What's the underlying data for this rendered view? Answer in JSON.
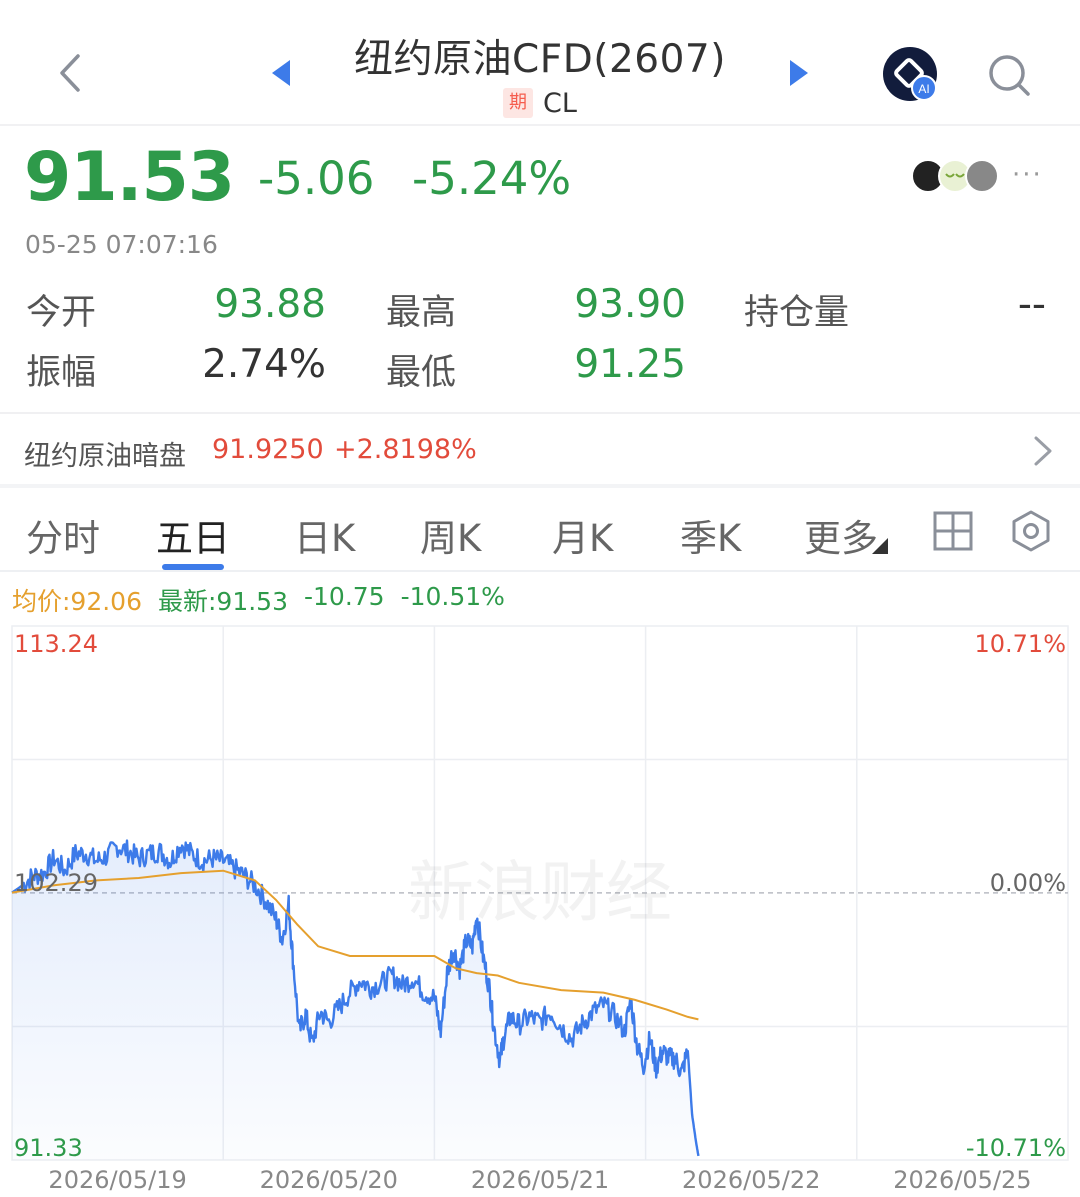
{
  "header": {
    "title": "纽约原油CFD(2607)",
    "badge": "期",
    "code": "CL",
    "ai_label": "AI"
  },
  "quote": {
    "price": "91.53",
    "change": "-5.06",
    "change_pct": "-5.24%",
    "timestamp": "05-25 07:07:16",
    "more": "···"
  },
  "stats": {
    "open_label": "今开",
    "open": "93.88",
    "high_label": "最高",
    "high": "93.90",
    "oi_label": "持仓量",
    "oi": "--",
    "amp_label": "振幅",
    "amp": "2.74%",
    "low_label": "最低",
    "low": "91.25"
  },
  "dark_pool": {
    "label": "纽约原油暗盘",
    "price": "91.9250",
    "pct": "+2.8198%"
  },
  "tabs": [
    {
      "label": "分时"
    },
    {
      "label": "五日"
    },
    {
      "label": "日K"
    },
    {
      "label": "周K"
    },
    {
      "label": "月K"
    },
    {
      "label": "季K"
    },
    {
      "label": "更多"
    }
  ],
  "chart_legend": {
    "avg": "均价:92.06",
    "latest": "最新:91.53",
    "change": "-10.75",
    "pct": "-10.51%"
  },
  "colors": {
    "down": "#2e9a4a",
    "up": "#e24b3b",
    "accent": "#3d7be9",
    "avg_line": "#e5a02e"
  },
  "chart_data": {
    "type": "line",
    "title": "",
    "y_left_ticks": [
      "113.24",
      "102.29",
      "91.33"
    ],
    "y_right_ticks": [
      "10.71%",
      "0.00%",
      "-10.71%"
    ],
    "ylim": [
      91.33,
      113.24
    ],
    "base_price": 102.29,
    "x_labels": [
      "2026/05/19",
      "2026/05/20",
      "2026/05/21",
      "2026/05/22",
      "2026/05/25"
    ],
    "watermark": "新浪财经",
    "series": [
      {
        "values": [
          [
            0.0,
            102.3
          ],
          [
            0.05,
            102.6
          ],
          [
            0.1,
            103.0
          ],
          [
            0.15,
            103.1
          ],
          [
            0.2,
            103.7
          ],
          [
            0.25,
            103.2
          ],
          [
            0.3,
            103.9
          ],
          [
            0.35,
            103.9
          ],
          [
            0.4,
            103.6
          ],
          [
            0.45,
            103.8
          ],
          [
            0.5,
            104.2
          ],
          [
            0.55,
            104.0
          ],
          [
            0.6,
            103.7
          ],
          [
            0.65,
            103.9
          ],
          [
            0.7,
            104.0
          ],
          [
            0.75,
            103.6
          ],
          [
            0.8,
            104.3
          ],
          [
            0.85,
            103.9
          ],
          [
            0.9,
            103.6
          ],
          [
            0.95,
            103.7
          ],
          [
            1.0,
            103.6
          ],
          [
            1.05,
            103.3
          ],
          [
            1.1,
            103.0
          ],
          [
            1.15,
            102.6
          ],
          [
            1.2,
            102.0
          ],
          [
            1.25,
            101.2
          ],
          [
            1.28,
            100.4
          ],
          [
            1.31,
            101.8
          ],
          [
            1.33,
            99.6
          ],
          [
            1.36,
            96.6
          ],
          [
            1.39,
            97.3
          ],
          [
            1.42,
            96.1
          ],
          [
            1.46,
            97.4
          ],
          [
            1.5,
            97.0
          ],
          [
            1.55,
            97.6
          ],
          [
            1.6,
            98.2
          ],
          [
            1.65,
            98.7
          ],
          [
            1.7,
            98.4
          ],
          [
            1.75,
            98.6
          ],
          [
            1.8,
            98.9
          ],
          [
            1.85,
            98.5
          ],
          [
            1.9,
            98.8
          ],
          [
            1.95,
            98.2
          ],
          [
            2.0,
            98.0
          ],
          [
            2.03,
            96.6
          ],
          [
            2.06,
            99.0
          ],
          [
            2.09,
            100.0
          ],
          [
            2.12,
            99.2
          ],
          [
            2.15,
            100.3
          ],
          [
            2.18,
            100.1
          ],
          [
            2.2,
            101.4
          ],
          [
            2.23,
            99.7
          ],
          [
            2.26,
            98.4
          ],
          [
            2.28,
            96.9
          ],
          [
            2.31,
            95.4
          ],
          [
            2.33,
            96.4
          ],
          [
            2.36,
            97.2
          ],
          [
            2.4,
            96.9
          ],
          [
            2.45,
            97.2
          ],
          [
            2.5,
            97.0
          ],
          [
            2.55,
            97.4
          ],
          [
            2.6,
            96.8
          ],
          [
            2.65,
            96.3
          ],
          [
            2.7,
            96.9
          ],
          [
            2.75,
            97.4
          ],
          [
            2.8,
            97.7
          ],
          [
            2.85,
            97.3
          ],
          [
            2.9,
            96.6
          ],
          [
            2.93,
            97.9
          ],
          [
            2.96,
            96.0
          ],
          [
            2.99,
            95.2
          ],
          [
            3.02,
            96.3
          ],
          [
            3.05,
            95.1
          ],
          [
            3.08,
            95.8
          ],
          [
            3.11,
            95.5
          ],
          [
            3.14,
            95.5
          ],
          [
            3.17,
            94.9
          ],
          [
            3.2,
            95.8
          ],
          [
            3.22,
            93.2
          ],
          [
            3.24,
            92.0
          ],
          [
            3.25,
            91.5
          ]
        ]
      },
      {
        "values": [
          [
            0.0,
            102.3
          ],
          [
            0.2,
            102.6
          ],
          [
            0.4,
            102.8
          ],
          [
            0.6,
            102.9
          ],
          [
            0.8,
            103.1
          ],
          [
            1.0,
            103.2
          ],
          [
            1.15,
            102.8
          ],
          [
            1.25,
            102.0
          ],
          [
            1.35,
            101.0
          ],
          [
            1.45,
            100.1
          ],
          [
            1.6,
            99.7
          ],
          [
            1.8,
            99.7
          ],
          [
            2.0,
            99.7
          ],
          [
            2.1,
            99.2
          ],
          [
            2.2,
            99.0
          ],
          [
            2.3,
            98.9
          ],
          [
            2.4,
            98.6
          ],
          [
            2.6,
            98.3
          ],
          [
            2.8,
            98.2
          ],
          [
            2.95,
            97.9
          ],
          [
            3.1,
            97.5
          ],
          [
            3.2,
            97.2
          ],
          [
            3.25,
            97.1
          ]
        ]
      }
    ]
  }
}
